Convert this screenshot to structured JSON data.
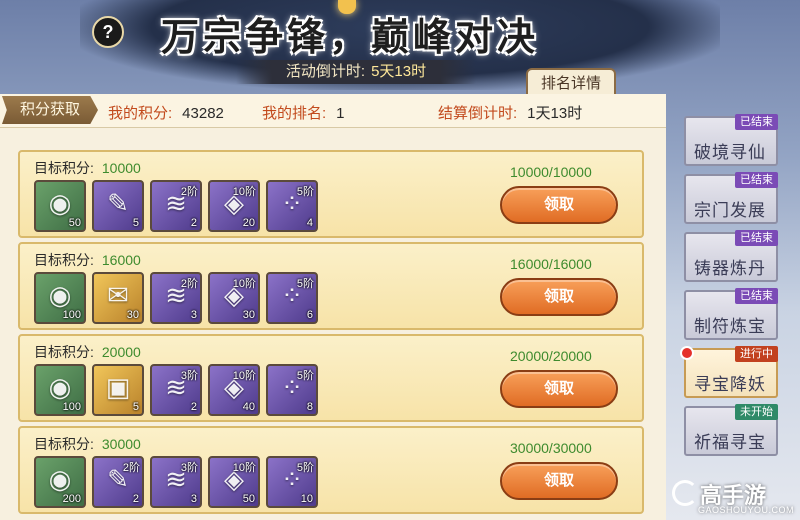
{
  "title": "万宗争锋，巅峰对决",
  "help_icon": "?",
  "activity_countdown": {
    "label": "活动倒计时:",
    "value": "5天13时"
  },
  "rank_detail_label": "排名详情",
  "points_tag": "积分获取",
  "my_points": {
    "label": "我的积分:",
    "value": "43282"
  },
  "my_rank": {
    "label": "我的排名:",
    "value": "1"
  },
  "settle_countdown": {
    "label": "结算倒计时:",
    "value": "1天13时"
  },
  "target_label": "目标积分:",
  "claim_label": "领取",
  "rewards": [
    {
      "target": "10000",
      "progress": "10000/10000",
      "items": [
        {
          "icon": "jade-ring-icon",
          "glyph": "◉",
          "color": "green",
          "grade": "",
          "count": "50"
        },
        {
          "icon": "scroll-book-icon",
          "glyph": "✎",
          "color": "purple",
          "grade": "",
          "count": "5"
        },
        {
          "icon": "scroll-icon",
          "glyph": "≋",
          "color": "purple",
          "grade": "2阶",
          "count": "2"
        },
        {
          "icon": "pouch-icon",
          "glyph": "◈",
          "color": "purple",
          "grade": "10阶",
          "count": "20"
        },
        {
          "icon": "beads-icon",
          "glyph": "⁘",
          "color": "purple",
          "grade": "5阶",
          "count": "4"
        }
      ]
    },
    {
      "target": "16000",
      "progress": "16000/16000",
      "items": [
        {
          "icon": "jade-ring-icon",
          "glyph": "◉",
          "color": "green",
          "grade": "",
          "count": "100"
        },
        {
          "icon": "talisman-icon",
          "glyph": "✉",
          "color": "purple",
          "grade": "",
          "count": "30"
        },
        {
          "icon": "scroll-icon",
          "glyph": "≋",
          "color": "purple",
          "grade": "2阶",
          "count": "3"
        },
        {
          "icon": "pouch-icon",
          "glyph": "◈",
          "color": "purple",
          "grade": "10阶",
          "count": "30"
        },
        {
          "icon": "beads-icon",
          "glyph": "⁘",
          "color": "purple",
          "grade": "5阶",
          "count": "6"
        }
      ]
    },
    {
      "target": "20000",
      "progress": "20000/20000",
      "items": [
        {
          "icon": "jade-ring-icon",
          "glyph": "◉",
          "color": "green",
          "grade": "",
          "count": "100"
        },
        {
          "icon": "chest-icon",
          "glyph": "▣",
          "color": "gold",
          "grade": "",
          "count": "5"
        },
        {
          "icon": "scroll-icon",
          "glyph": "≋",
          "color": "purple",
          "grade": "3阶",
          "count": "2"
        },
        {
          "icon": "pouch-icon",
          "glyph": "◈",
          "color": "purple",
          "grade": "10阶",
          "count": "40"
        },
        {
          "icon": "beads-icon",
          "glyph": "⁘",
          "color": "purple",
          "grade": "5阶",
          "count": "8"
        }
      ]
    },
    {
      "target": "30000",
      "progress": "30000/30000",
      "items": [
        {
          "icon": "jade-ring-icon",
          "glyph": "◉",
          "color": "green",
          "grade": "",
          "count": "200"
        },
        {
          "icon": "scroll-book-icon",
          "glyph": "✎",
          "color": "purple",
          "grade": "2阶",
          "count": "2"
        },
        {
          "icon": "scroll-icon",
          "glyph": "≋",
          "color": "purple",
          "grade": "3阶",
          "count": "3"
        },
        {
          "icon": "pouch-icon",
          "glyph": "◈",
          "color": "purple",
          "grade": "10阶",
          "count": "50"
        },
        {
          "icon": "beads-icon",
          "glyph": "⁘",
          "color": "purple",
          "grade": "5阶",
          "count": "10"
        }
      ]
    }
  ],
  "side_tabs": [
    {
      "label": "破境寻仙",
      "status": "已结束",
      "state": "ended"
    },
    {
      "label": "宗门发展",
      "status": "已结束",
      "state": "ended"
    },
    {
      "label": "铸器炼丹",
      "status": "已结束",
      "state": "ended"
    },
    {
      "label": "制符炼宝",
      "status": "已结束",
      "state": "ended"
    },
    {
      "label": "寻宝降妖",
      "status": "进行中",
      "state": "ongoing"
    },
    {
      "label": "祈福寻宝",
      "status": "未开始",
      "state": "notstarted"
    }
  ],
  "watermark": {
    "main": "高手游",
    "sub": "GAOSHOUYOU.COM"
  },
  "colors": {
    "accent_orange": "#e06c24",
    "points_green": "#3e8b2e",
    "label_red": "#c24a1d"
  }
}
